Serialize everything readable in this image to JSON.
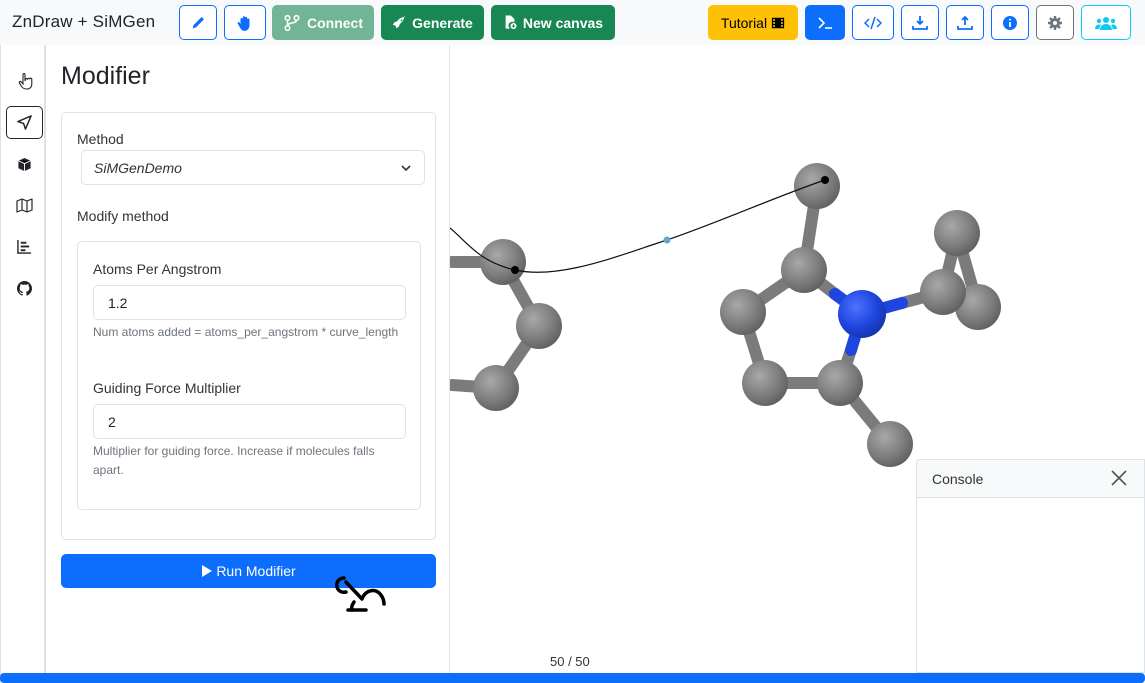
{
  "app": {
    "title": "ZnDraw + SiMGen"
  },
  "toolbar": {
    "connect_label": "Connect",
    "generate_label": "Generate",
    "new_canvas_label": "New canvas",
    "tutorial_label": "Tutorial",
    "icons": [
      "pencil-icon",
      "hand-icon",
      "film-icon",
      "terminal-icon",
      "code-icon",
      "download-icon",
      "upload-icon",
      "info-icon",
      "gear-icon",
      "users-icon"
    ]
  },
  "sidebar": {
    "items": [
      {
        "name": "interaction",
        "icon": "pointer-hand-icon"
      },
      {
        "name": "modifier",
        "icon": "send-icon",
        "active": true
      },
      {
        "name": "scene",
        "icon": "box-icon"
      },
      {
        "name": "map",
        "icon": "map-icon"
      },
      {
        "name": "analysis",
        "icon": "chart-icon"
      },
      {
        "name": "github",
        "icon": "github-icon"
      }
    ]
  },
  "panel": {
    "title": "Modifier",
    "method_label": "Method",
    "method_value": "SiMGenDemo",
    "modify_method_label": "Modify method",
    "fields": [
      {
        "label": "Atoms Per Angstrom",
        "value": "1.2",
        "help": "Num atoms added = atoms_per_angstrom * curve_length"
      },
      {
        "label": "Guiding Force Multiplier",
        "value": "2",
        "help": "Multiplier for guiding force. Increase if molecules falls apart."
      }
    ],
    "run_label": "Run Modifier"
  },
  "viewer": {
    "frame_counter": "50 / 50",
    "progress_fraction": 1.0
  },
  "console": {
    "title": "Console"
  },
  "colors": {
    "primary": "#0d6efd",
    "success": "#198754",
    "warning": "#ffc107",
    "info": "#0dcaf0",
    "atom_carbon": "#808080",
    "atom_nitrogen": "#1f45e0"
  }
}
